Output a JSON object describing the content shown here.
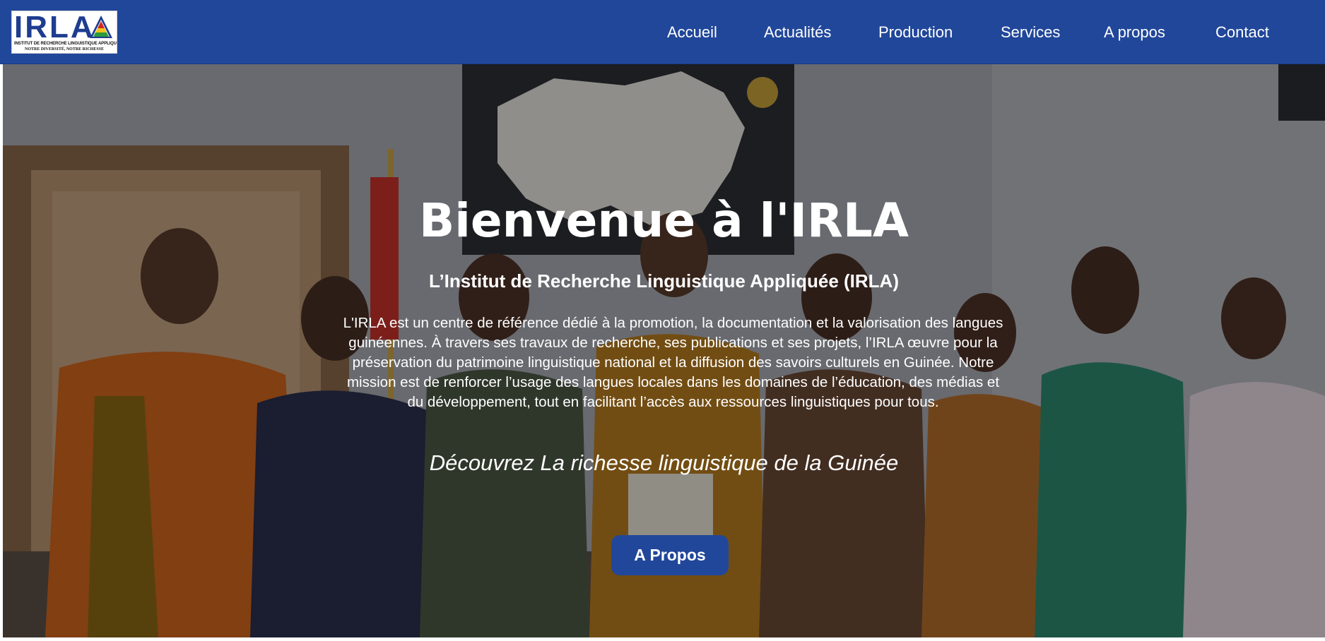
{
  "header": {
    "logo": {
      "mark": "IRLA",
      "line1": "INSTITUT DE RECHERCHE LINGUISTIQUE APPLIQUÉE",
      "line2": "NOTRE DIVERSITÉ, NOTRE RICHESSE"
    },
    "nav": [
      {
        "label": "Accueil"
      },
      {
        "label": "Actualités"
      },
      {
        "label": "Production"
      },
      {
        "label": "Services"
      },
      {
        "label": "A propos"
      },
      {
        "label": "Contact"
      }
    ]
  },
  "hero": {
    "title": "Bienvenue à l'IRLA",
    "subtitle": "L’Institut de Recherche Linguistique Appliquée (IRLA)",
    "description": "L'IRLA est un centre de référence dédié à la promotion, la documentation et la valorisation des langues guinéennes. À travers ses travaux de recherche, ses publications et ses projets, l’IRLA œuvre pour la préservation du patrimoine linguistique national et la diffusion des savoirs culturels en Guinée. Notre mission est de renforcer l’usage des langues locales dans les domaines de l’éducation, des médias et du développement, tout en facilitant l’accès aux ressources linguistiques pour tous.",
    "tagline": "Découvrez La richesse linguistique de la Guinée",
    "button_label": "A Propos"
  },
  "colors": {
    "brand": "#21479a",
    "text_on_brand": "#ffffff"
  }
}
